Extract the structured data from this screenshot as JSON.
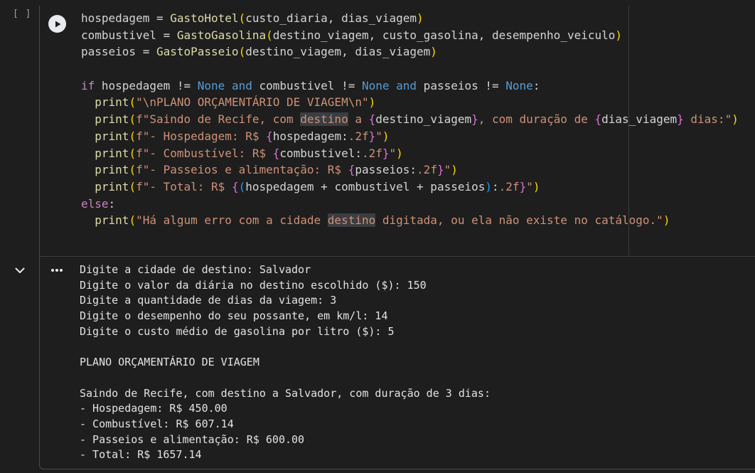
{
  "cell": {
    "execution_count": "[ ]"
  },
  "code": {
    "line1": {
      "a": "hospedagem = ",
      "b": "GastoHotel",
      "c": "(",
      "d": "custo_diaria, dias_viagem",
      "e": ")"
    },
    "line2": {
      "a": "combustivel = ",
      "b": "GastoGasolina",
      "c": "(",
      "d": "destino_viagem, custo_gasolina, desempenho_veiculo",
      "e": ")"
    },
    "line3": {
      "a": "passeios = ",
      "b": "GastoPasseio",
      "c": "(",
      "d": "destino_viagem, dias_viagem",
      "e": ")"
    },
    "line5": {
      "if": "if",
      "v1": " hospedagem != ",
      "n1": "None",
      "and1": "and",
      "v2": " combustivel != ",
      "n2": "None",
      "and2": "and",
      "v3": " passeios != ",
      "n3": "None",
      "colon": ":"
    },
    "line6": {
      "fn": "print",
      "op": "(",
      "s": "\"\\nPLANO ORÇAMENTÁRIO DE VIAGEM\\n\"",
      "cp": ")"
    },
    "line7": {
      "fn": "print",
      "op": "(",
      "s1": "f\"Saindo de Recife, com ",
      "hl": "destino",
      "s2": " a ",
      "ob1": "{",
      "v1": "destino_viagem",
      "cb1": "}",
      "s3": ", com duração de ",
      "ob2": "{",
      "v2": "dias_viagem",
      "cb2": "}",
      "s4": " dias:\"",
      "cp": ")"
    },
    "line8": {
      "fn": "print",
      "op": "(",
      "s1": "f\"- Hospedagem: R$ ",
      "ob": "{",
      "v": "hospedagem:",
      "fmt": ".2f",
      "cb": "}",
      "s2": "\"",
      "cp": ")"
    },
    "line9": {
      "fn": "print",
      "op": "(",
      "s1": "f\"- Combustível: R$ ",
      "ob": "{",
      "v": "combustivel:",
      "fmt": ".2f",
      "cb": "}",
      "s2": "\"",
      "cp": ")"
    },
    "line10": {
      "fn": "print",
      "op": "(",
      "s1": "f\"- Passeios e alimentação: R$ ",
      "ob": "{",
      "v": "passeios:",
      "fmt": ".2f",
      "cb": "}",
      "s2": "\"",
      "cp": ")"
    },
    "line11": {
      "fn": "print",
      "op": "(",
      "s1": "f\"- Total: R$ ",
      "ob": "{",
      "ip": "(",
      "v": "hospedagem + combustivel + passeios",
      "icp": ")",
      "colon": ":",
      "fmt": ".2f",
      "cb": "}",
      "s2": "\"",
      "cp": ")"
    },
    "line12": {
      "else": "else",
      "colon": ":"
    },
    "line13": {
      "fn": "print",
      "op": "(",
      "s1": "\"Há algum erro com a cidade ",
      "hl": "destino",
      "s2": " digitada, ou ela não existe no catálogo.\"",
      "cp": ")"
    }
  },
  "output": {
    "lines": [
      "Digite a cidade de destino: Salvador",
      "Digite o valor da diária no destino escolhido ($): 150",
      "Digite a quantidade de dias da viagem: 3",
      "Digite o desempenho do seu possante, em km/l: 14",
      "Digite o custo médio de gasolina por litro ($): 5",
      "",
      "PLANO ORÇAMENTÁRIO DE VIAGEM",
      "",
      "Saindo de Recife, com destino a Salvador, com duração de 3 dias:",
      "- Hospedagem: R$ 450.00",
      "- Combustível: R$ 607.14",
      "- Passeios e alimentação: R$ 600.00",
      "- Total: R$ 1657.14"
    ]
  },
  "icons": {
    "run": "play-circle-icon",
    "collapse": "chevron-down-icon",
    "menu": "more-horizontal-icon"
  },
  "colors": {
    "background": "#1e1e1e",
    "keyword": "#569cd6",
    "control": "#c586c0",
    "function": "#dcdcaa",
    "string": "#ce9178",
    "bracket": "#ffd700",
    "bracket2": "#da70d6",
    "bracket3": "#179fff",
    "text": "#d4d4d4"
  }
}
